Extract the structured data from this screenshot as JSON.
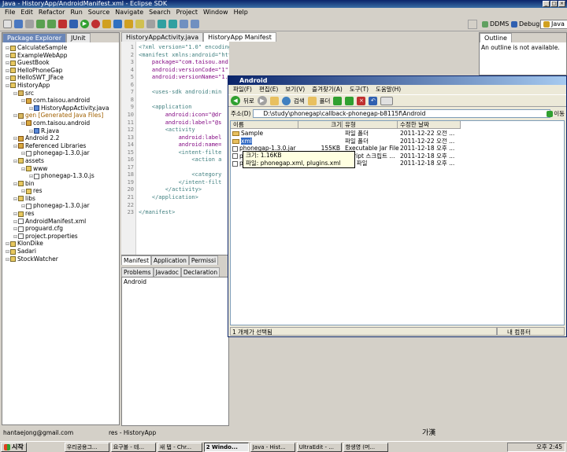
{
  "window": {
    "title": "Java - HistoryApp/AndroidManifest.xml - Eclipse SDK"
  },
  "menu": [
    "File",
    "Edit",
    "Refactor",
    "Run",
    "Source",
    "Navigate",
    "Search",
    "Project",
    "Window",
    "Help"
  ],
  "perspectives": {
    "ddms": "DDMS",
    "debug": "Debug",
    "java": "Java"
  },
  "left_tabs": {
    "explorer": "Package Explorer",
    "junit": "JUnit"
  },
  "tree": [
    {
      "label": "CalculateSample",
      "indent": 0,
      "icon": "folder"
    },
    {
      "label": "ExampleWebApp",
      "indent": 0,
      "icon": "folder"
    },
    {
      "label": "GuestBook",
      "indent": 0,
      "icon": "folder"
    },
    {
      "label": "HelloPhoneGap",
      "indent": 0,
      "icon": "folder"
    },
    {
      "label": "HelloSWT_JFace",
      "indent": 0,
      "icon": "folder"
    },
    {
      "label": "HistoryApp",
      "indent": 0,
      "icon": "folder"
    },
    {
      "label": "src",
      "indent": 1,
      "icon": "src"
    },
    {
      "label": "com.taisou.android",
      "indent": 2,
      "icon": "pkg"
    },
    {
      "label": "HistoryAppActivity.java",
      "indent": 3,
      "icon": "java"
    },
    {
      "label": "gen [Generated Java Files]",
      "indent": 1,
      "icon": "src",
      "gen": true
    },
    {
      "label": "com.taisou.android",
      "indent": 2,
      "icon": "pkg"
    },
    {
      "label": "R.java",
      "indent": 3,
      "icon": "java"
    },
    {
      "label": "Android 2.2",
      "indent": 1,
      "icon": "pkg"
    },
    {
      "label": "Referenced Libraries",
      "indent": 1,
      "icon": "pkg"
    },
    {
      "label": "phonegap-1.3.0.jar",
      "indent": 2,
      "icon": "file"
    },
    {
      "label": "assets",
      "indent": 1,
      "icon": "folder"
    },
    {
      "label": "www",
      "indent": 2,
      "icon": "folder"
    },
    {
      "label": "phonegap-1.3.0.js",
      "indent": 3,
      "icon": "file"
    },
    {
      "label": "bin",
      "indent": 1,
      "icon": "folder"
    },
    {
      "label": "res",
      "indent": 2,
      "icon": "folder"
    },
    {
      "label": "libs",
      "indent": 1,
      "icon": "folder"
    },
    {
      "label": "phonegap-1.3.0.jar",
      "indent": 2,
      "icon": "file"
    },
    {
      "label": "res",
      "indent": 1,
      "icon": "folder"
    },
    {
      "label": "AndroidManifest.xml",
      "indent": 1,
      "icon": "file"
    },
    {
      "label": "proguard.cfg",
      "indent": 1,
      "icon": "file"
    },
    {
      "label": "project.properties",
      "indent": 1,
      "icon": "file"
    },
    {
      "label": "KlonDike",
      "indent": 0,
      "icon": "folder"
    },
    {
      "label": "Sadari",
      "indent": 0,
      "icon": "folder"
    },
    {
      "label": "StockWatcher",
      "indent": 0,
      "icon": "folder"
    }
  ],
  "editor_tabs": [
    "HistoryAppActivity.java",
    "HistoryApp Manifest"
  ],
  "outline": {
    "tab": "Outline",
    "message": "An outline is not available."
  },
  "code": [
    {
      "n": "1",
      "t": "<?xml version=\"1.0\" encoding=\"utf-8\"?>",
      "c": "cl"
    },
    {
      "n": "2",
      "t": "<manifest xmlns:android=\"http://schemas.android.com/apk/res/android\"",
      "c": "cl"
    },
    {
      "n": "3",
      "t": "    package=\"com.taisou.android\"",
      "c": "cl attr"
    },
    {
      "n": "4",
      "t": "    android:versionCode=\"1\"",
      "c": "cl attr"
    },
    {
      "n": "5",
      "t": "    android:versionName=\"1.0\" >",
      "c": "cl attr"
    },
    {
      "n": "6",
      "t": "",
      "c": "cl"
    },
    {
      "n": "7",
      "t": "    <uses-sdk android:min",
      "c": "cl"
    },
    {
      "n": "8",
      "t": "",
      "c": "cl"
    },
    {
      "n": "9",
      "t": "    <application",
      "c": "cl"
    },
    {
      "n": "10",
      "t": "        android:icon=\"@dr",
      "c": "cl attr"
    },
    {
      "n": "11",
      "t": "        android:label=\"@s",
      "c": "cl attr"
    },
    {
      "n": "12",
      "t": "        <activity",
      "c": "cl"
    },
    {
      "n": "13",
      "t": "            android:label",
      "c": "cl attr"
    },
    {
      "n": "14",
      "t": "            android:name=",
      "c": "cl attr"
    },
    {
      "n": "15",
      "t": "            <intent-filte",
      "c": "cl"
    },
    {
      "n": "16",
      "t": "                <action a",
      "c": "cl"
    },
    {
      "n": "17",
      "t": "",
      "c": "cl"
    },
    {
      "n": "18",
      "t": "                <category",
      "c": "cl"
    },
    {
      "n": "19",
      "t": "            </intent-filt",
      "c": "cl"
    },
    {
      "n": "20",
      "t": "        </activity>",
      "c": "cl"
    },
    {
      "n": "21",
      "t": "    </application>",
      "c": "cl"
    },
    {
      "n": "22",
      "t": "",
      "c": "cl"
    },
    {
      "n": "23",
      "t": "</manifest>",
      "c": "cl"
    }
  ],
  "editor_bottom_tabs": [
    "Manifest",
    "Application",
    "Permissi"
  ],
  "bottom_tabs": [
    "Problems",
    "Javadoc",
    "Declaration"
  ],
  "bottom_panel_label": "Android",
  "status": {
    "left": "hantaejong@gmail.com",
    "center": "res - HistoryApp"
  },
  "explorer": {
    "title": "Android",
    "menu": [
      "파일(F)",
      "편집(E)",
      "보기(V)",
      "즐겨찾기(A)",
      "도구(T)",
      "도움말(H)"
    ],
    "back": "뒤로",
    "search": "검색",
    "folders": "폴더",
    "address_label": "주소(D)",
    "address": "D:\\study\\phonegap\\callback-phonegap-b8115f\\Android",
    "go": "이동",
    "columns": [
      "이름",
      "크기",
      "유형",
      "수정한 날짜"
    ],
    "rows": [
      {
        "name": "Sample",
        "size": "",
        "type": "파일 폴더",
        "date": "2011-12-22 오전 ...",
        "folder": true
      },
      {
        "name": "xml",
        "size": "",
        "type": "파일 폴더",
        "date": "2011-12-22 오전 ...",
        "folder": true,
        "selected": true
      },
      {
        "name": "phonegap-1.3.0.jar",
        "size": "155KB",
        "type": "Executable Jar File",
        "date": "2011-12-18 오후 ...",
        "folder": false
      },
      {
        "name": "ph",
        "size": "143KB",
        "type": "JScript 스크립트 ...",
        "date": "2011-12-18 오후 ...",
        "folder": false
      },
      {
        "name": "pl",
        "size": "5KB",
        "type": "MO 파일",
        "date": "2011-12-18 오후 ...",
        "folder": false
      }
    ],
    "tooltip": [
      "크기: 1.16KB",
      "파일: phonegap.xml, plugins.xml"
    ],
    "status_left": "1 개체가 선택됨",
    "status_right": "내 컴퓨터"
  },
  "taskbar": {
    "start": "시작",
    "tasks": [
      "우리공용그...",
      "요구불 - 테...",
      "새 탭 - Chr...",
      "2 Windo...",
      "Java - Hist...",
      "UltraEdit - ...",
      "항생영 (머..."
    ],
    "active_index": 3,
    "ime": "가漢",
    "clock": "오후 2:45"
  }
}
